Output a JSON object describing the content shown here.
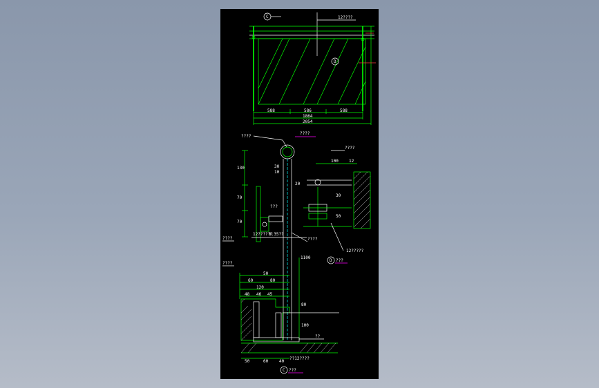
{
  "colors": {
    "background": "#000000",
    "line": "#00ff00",
    "text": "#ffffff",
    "leader": "#00ffff",
    "accent": "#ff3b3b",
    "underline": "#ff00ff",
    "hatch": "#c8c8c8"
  },
  "elevation": {
    "callout_top": "C",
    "callout_panel": "D",
    "note_top": "12????",
    "dims_bays": [
      "588",
      "586",
      "588"
    ],
    "dim_inner": "1864",
    "dim_overall": "2054"
  },
  "section": {
    "title": "????",
    "dims_left": [
      "130",
      "70",
      "70"
    ],
    "note_cap": "????",
    "dim_rail_a": "30",
    "dim_rail_b": "10",
    "label_clamp": "???",
    "label_bracket_a": "12??????",
    "label_bracket_b": "8.35??",
    "note_mid_left": "????",
    "note_mid_right": "????",
    "dim_post_height": "1100",
    "note_low_left": "????",
    "dims_base": [
      "50",
      "60",
      "80",
      "120",
      "48",
      "45",
      "46"
    ],
    "dim_side": "80",
    "dim_foot": "100",
    "note_floor": "??",
    "note_bolt": "??12????",
    "dims_bottom": [
      "50",
      "60",
      "40"
    ],
    "callout_label": "???"
  },
  "detail_d": {
    "note_top": "????",
    "dims_top": [
      "100",
      "12"
    ],
    "dim_side": "20",
    "dims_right": [
      "30",
      "50"
    ],
    "note_bottom": "12?????",
    "callout_label": "???"
  }
}
